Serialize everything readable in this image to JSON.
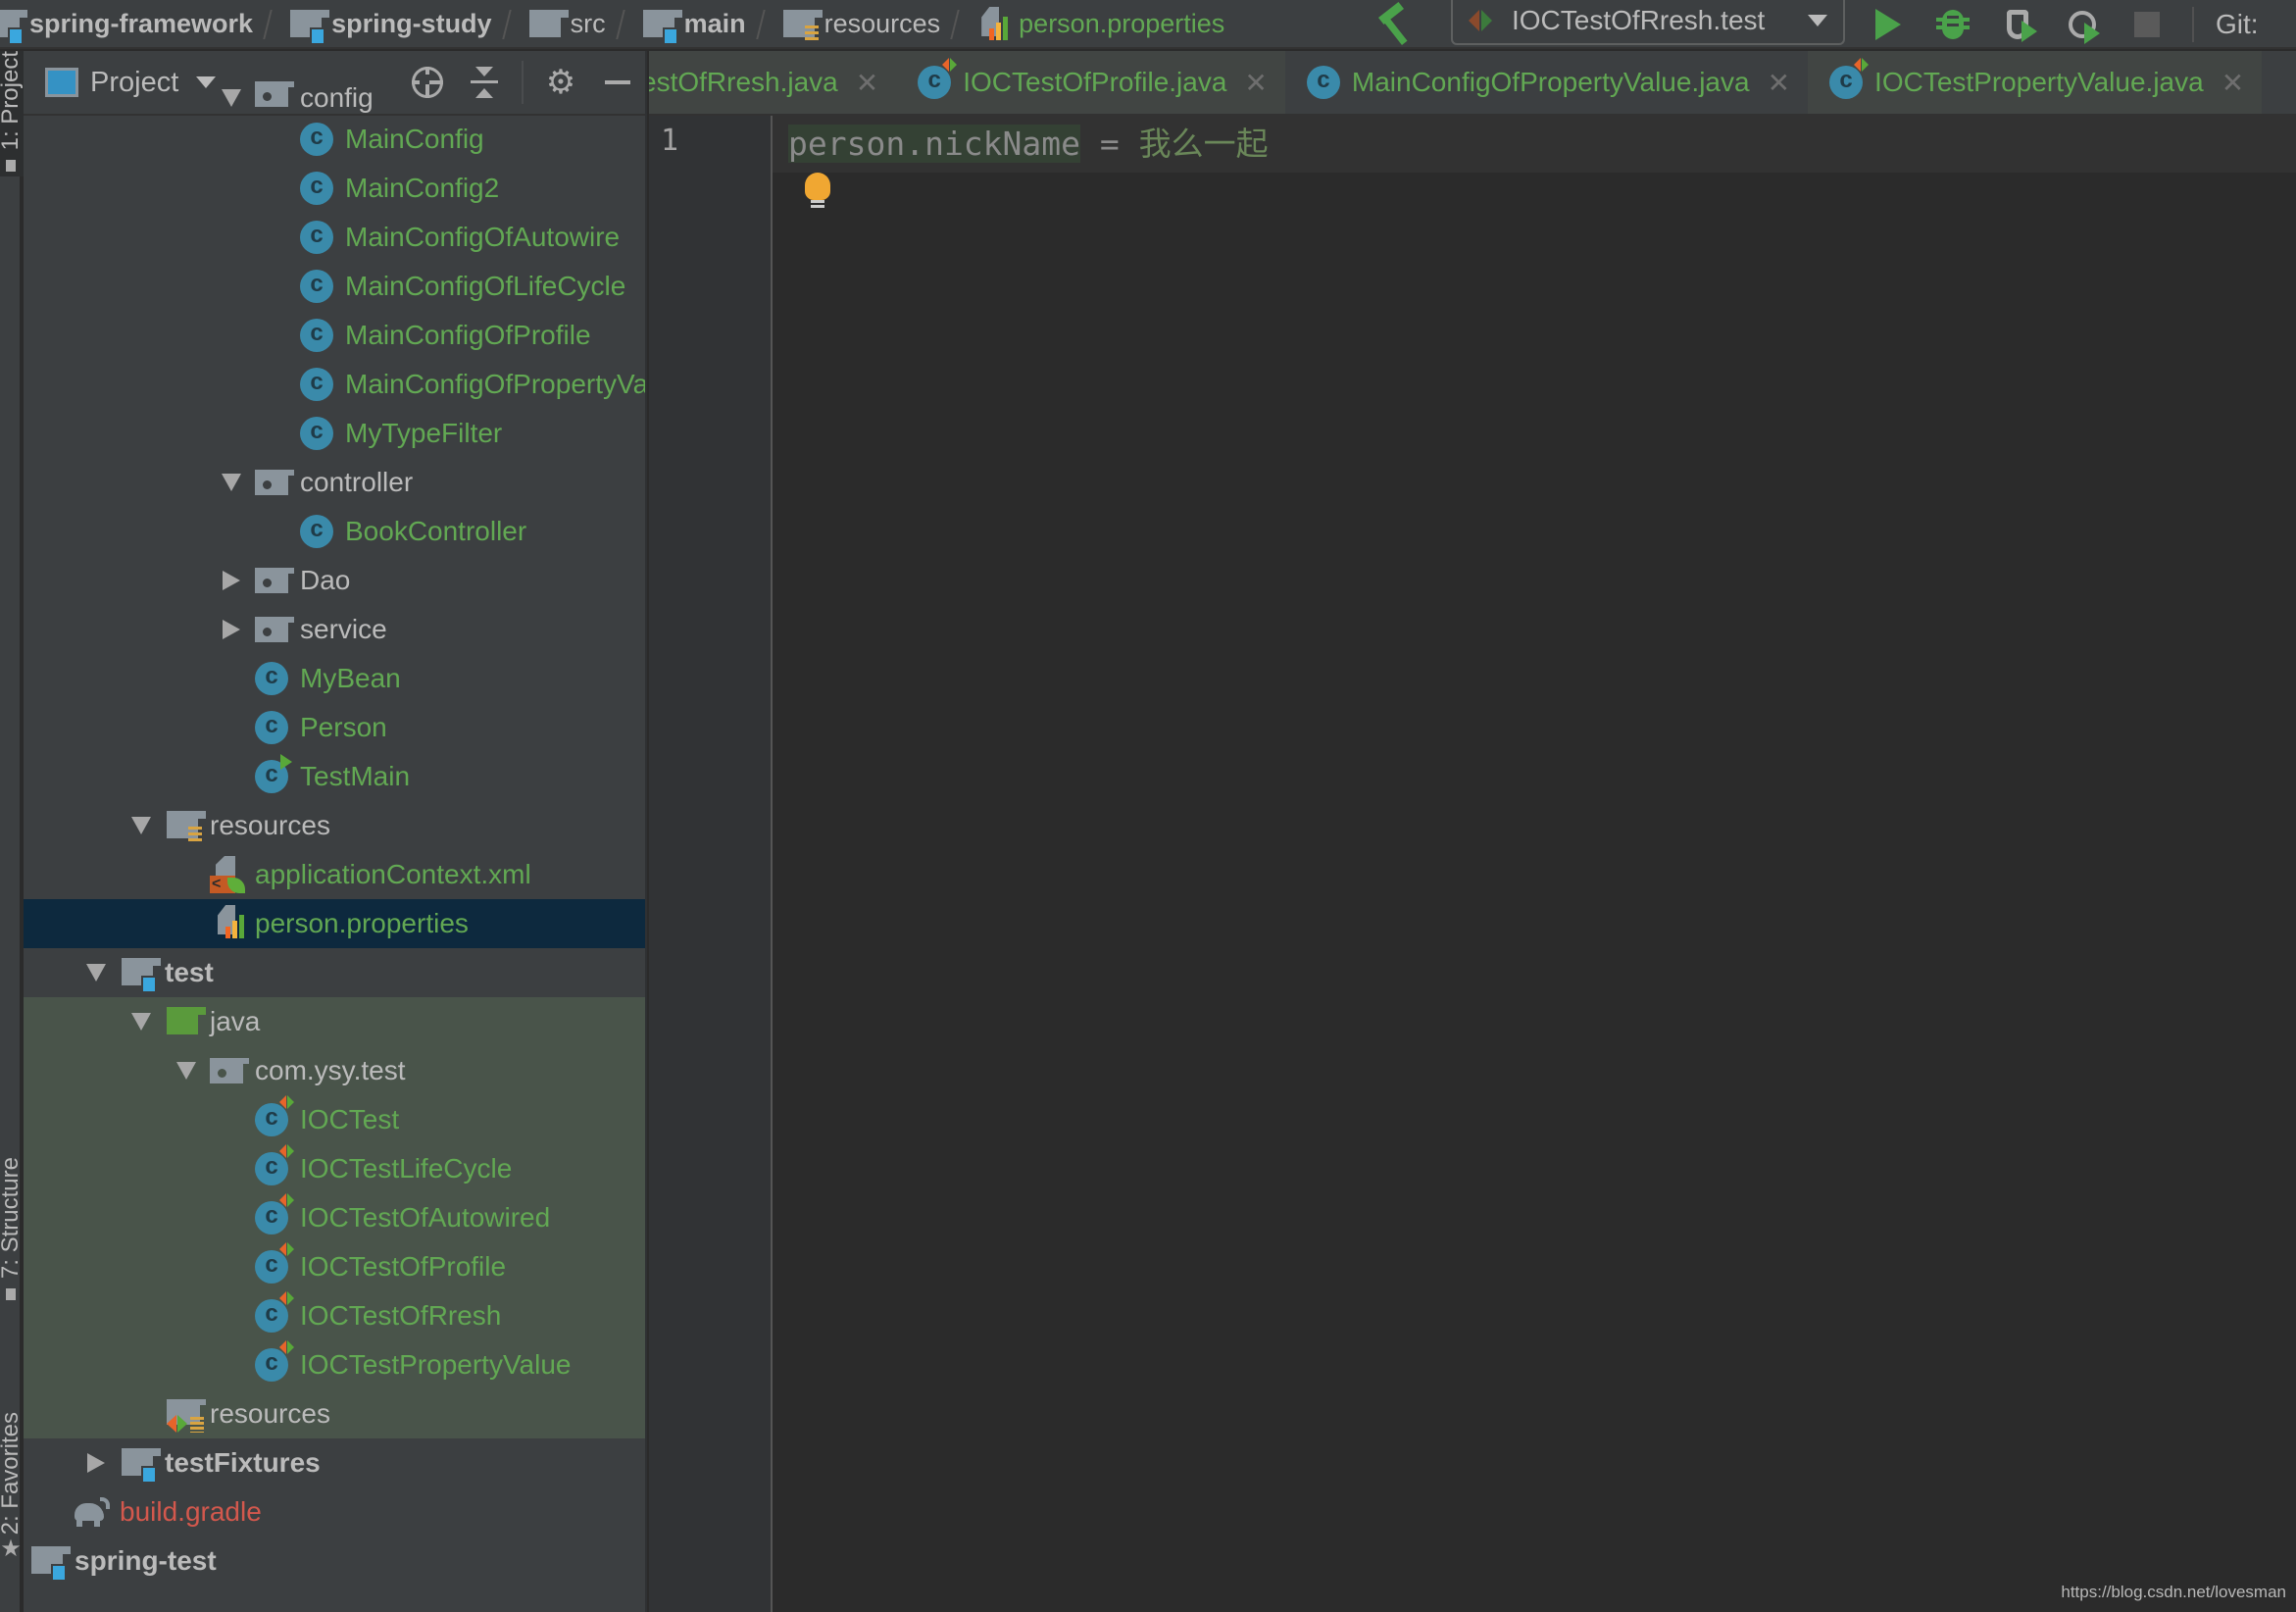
{
  "navbar": {
    "breadcrumbs": [
      {
        "label": "spring-framework",
        "icon": "module-folder-icon"
      },
      {
        "label": "spring-study",
        "icon": "module-folder-icon"
      },
      {
        "label": "src",
        "icon": "folder-icon"
      },
      {
        "label": "main",
        "icon": "module-folder-icon"
      },
      {
        "label": "resources",
        "icon": "resources-folder-icon"
      },
      {
        "label": "person.properties",
        "icon": "properties-file-icon"
      }
    ],
    "run_config": "IOCTestOfRresh.test",
    "git_label": "Git:"
  },
  "tool_stripe": {
    "project_tab": "1: Project",
    "structure_tab": "7: Structure",
    "favorites_tab": "2: Favorites"
  },
  "project_panel": {
    "title": "Project",
    "tree": [
      {
        "label": "config",
        "type": "package",
        "expanded": true,
        "color": "gray"
      },
      {
        "label": "MainConfig",
        "type": "class",
        "color": "green"
      },
      {
        "label": "MainConfig2",
        "type": "class",
        "color": "green"
      },
      {
        "label": "MainConfigOfAutowire",
        "type": "class",
        "color": "green"
      },
      {
        "label": "MainConfigOfLifeCycle",
        "type": "class",
        "color": "green"
      },
      {
        "label": "MainConfigOfProfile",
        "type": "class",
        "color": "green"
      },
      {
        "label": "MainConfigOfPropertyValue",
        "type": "class",
        "color": "green"
      },
      {
        "label": "MyTypeFilter",
        "type": "class",
        "color": "green"
      },
      {
        "label": "controller",
        "type": "package",
        "expanded": true,
        "color": "gray"
      },
      {
        "label": "BookController",
        "type": "class",
        "color": "green"
      },
      {
        "label": "Dao",
        "type": "package",
        "expanded": false,
        "color": "gray"
      },
      {
        "label": "service",
        "type": "package",
        "expanded": false,
        "color": "gray"
      },
      {
        "label": "MyBean",
        "type": "class",
        "color": "green"
      },
      {
        "label": "Person",
        "type": "class",
        "color": "green"
      },
      {
        "label": "TestMain",
        "type": "runnable-class",
        "color": "green"
      },
      {
        "label": "resources",
        "type": "resources-folder",
        "expanded": true,
        "color": "gray"
      },
      {
        "label": "applicationContext.xml",
        "type": "spring-xml",
        "color": "green"
      },
      {
        "label": "person.properties",
        "type": "properties",
        "color": "green",
        "selected": true
      },
      {
        "label": "test",
        "type": "module-folder",
        "expanded": true,
        "color": "gray"
      },
      {
        "label": "java",
        "type": "test-source-folder",
        "expanded": true,
        "color": "gray"
      },
      {
        "label": "com.ysy.test",
        "type": "package",
        "expanded": true,
        "color": "gray"
      },
      {
        "label": "IOCTest",
        "type": "test-class",
        "color": "green"
      },
      {
        "label": "IOCTestLifeCycle",
        "type": "test-class",
        "color": "green"
      },
      {
        "label": "IOCTestOfAutowired",
        "type": "test-class",
        "color": "green"
      },
      {
        "label": "IOCTestOfProfile",
        "type": "test-class",
        "color": "green"
      },
      {
        "label": "IOCTestOfRresh",
        "type": "test-class",
        "color": "green"
      },
      {
        "label": "IOCTestPropertyValue",
        "type": "test-class",
        "color": "green"
      },
      {
        "label": "resources",
        "type": "test-resources-folder",
        "color": "gray"
      },
      {
        "label": "testFixtures",
        "type": "module-folder",
        "expanded": false,
        "color": "gray"
      },
      {
        "label": "build.gradle",
        "type": "gradle",
        "color": "red"
      },
      {
        "label": "spring-test",
        "type": "module-folder",
        "color": "gray"
      }
    ]
  },
  "editor": {
    "tabs": [
      {
        "label": "IOCTestOfRresh.java",
        "visible_label": "estOfRresh.java",
        "icon": "test-class-icon"
      },
      {
        "label": "IOCTestOfProfile.java",
        "icon": "test-class-icon"
      },
      {
        "label": "MainConfigOfPropertyValue.java",
        "icon": "class-icon"
      },
      {
        "label": "IOCTestPropertyValue.java",
        "icon": "test-class-icon"
      }
    ],
    "line_number": "1",
    "code": {
      "key": "person.nickName",
      "equals": " = ",
      "value": "我么一起"
    }
  },
  "watermark": "https://blog.csdn.net/lovesman",
  "colors": {
    "file_green": "#62a853",
    "gradle_red": "#d3584d",
    "selection": "#0d293e",
    "test_bg": "#49544a"
  }
}
